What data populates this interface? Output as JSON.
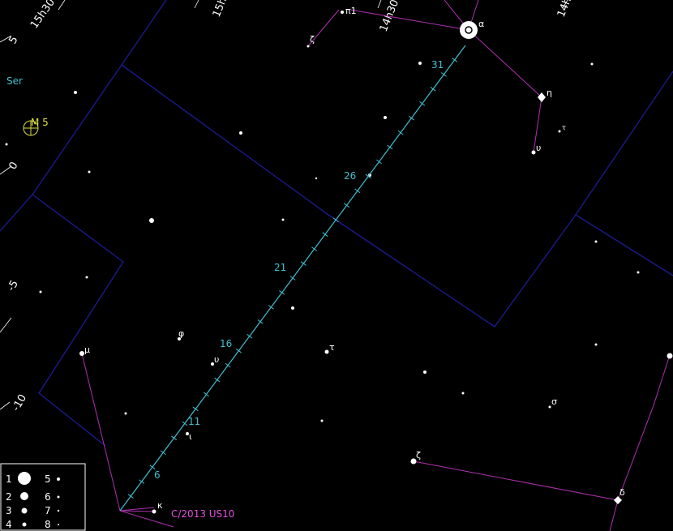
{
  "colors": {
    "background": "#000000",
    "boundary": "#1a1a8c",
    "constellation_lines": "#b030b0",
    "comet_path": "#40c0d0",
    "comet_label": "#e050e0",
    "grid": "#ffffff",
    "object": "#e0e040",
    "constellation_abbrev": "#40c0d0",
    "star_label": "#ffffff"
  },
  "grid_labels": {
    "ra_15h30": "15h30",
    "ra_15h": "15h",
    "ra_14h30": "14h30",
    "ra_14h": "14h",
    "dec_plus5_top": "5",
    "dec_0": "0",
    "dec_minus5": "-5",
    "dec_minus10": "-10"
  },
  "constellation_abbrev": "Ser",
  "deep_sky": {
    "label": "M 5"
  },
  "star_labels": {
    "pi1": "π1",
    "zeta_top": "ζ",
    "alpha": "α",
    "eta": "η",
    "tau_small": "τ",
    "upsilon_r": "υ",
    "phi": "φ",
    "mu": "μ",
    "upsilon": "υ",
    "tau": "τ",
    "iota": "ι",
    "sigma": "σ",
    "zeta": "ζ",
    "delta": "δ",
    "kappa": "κ"
  },
  "comet": {
    "name": "C/2013 US10",
    "date_labels": [
      "6",
      "11",
      "16",
      "21",
      "26",
      "31"
    ]
  },
  "legend": {
    "magnitudes": [
      "1",
      "2",
      "3",
      "4",
      "5",
      "6",
      "7",
      "8"
    ]
  }
}
